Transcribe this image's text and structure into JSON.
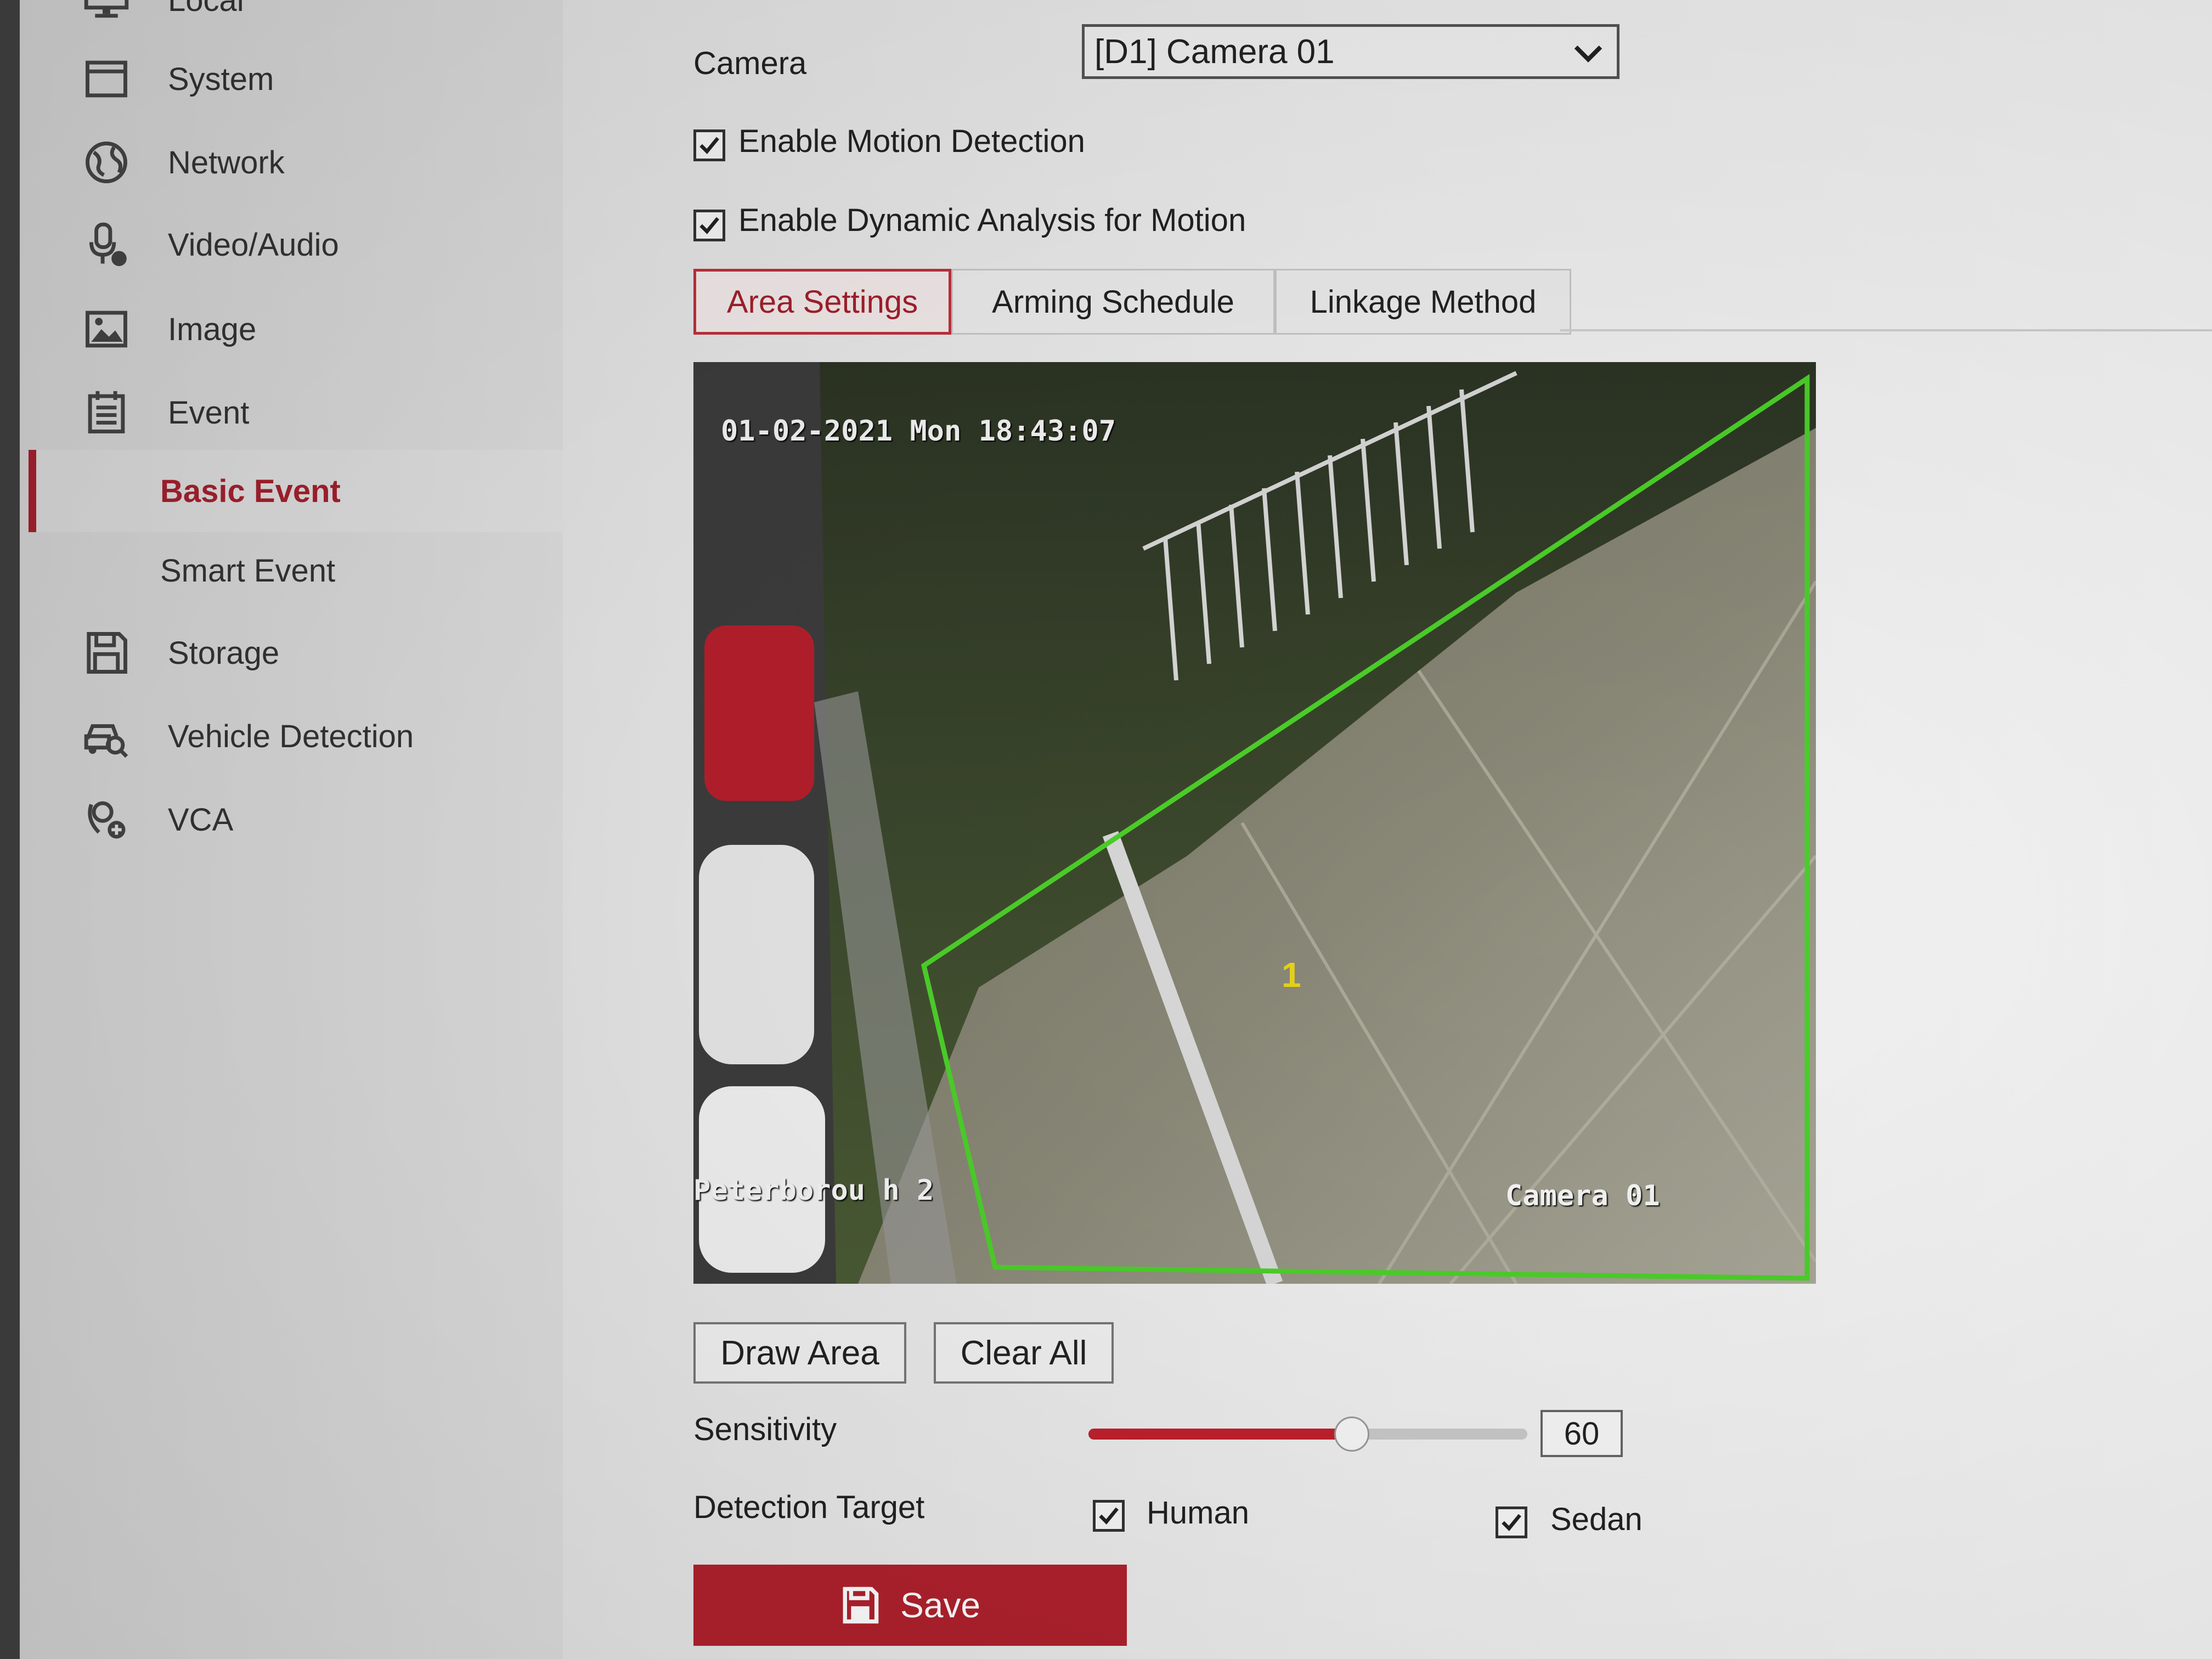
{
  "sidebar": {
    "items": [
      {
        "label": "Local",
        "icon": "monitor-icon"
      },
      {
        "label": "System",
        "icon": "system-icon"
      },
      {
        "label": "Network",
        "icon": "globe-icon"
      },
      {
        "label": "Video/Audio",
        "icon": "microphone-icon"
      },
      {
        "label": "Image",
        "icon": "image-icon"
      },
      {
        "label": "Event",
        "icon": "calendar-icon"
      },
      {
        "label": "Storage",
        "icon": "floppy-icon"
      },
      {
        "label": "Vehicle Detection",
        "icon": "vehicle-search-icon"
      },
      {
        "label": "VCA",
        "icon": "vca-icon"
      }
    ],
    "sub_items": [
      {
        "label": "Basic Event",
        "active": true
      },
      {
        "label": "Smart Event",
        "active": false
      }
    ],
    "accent_color": "#a3202d"
  },
  "form": {
    "camera_label": "Camera",
    "camera_value": "[D1] Camera 01",
    "enable_motion_label": "Enable Motion Detection",
    "enable_motion_checked": true,
    "enable_dynamic_label": "Enable Dynamic Analysis for Motion",
    "enable_dynamic_checked": true
  },
  "tabs": [
    {
      "label": "Area Settings",
      "active": true
    },
    {
      "label": "Arming Schedule",
      "active": false
    },
    {
      "label": "Linkage Method",
      "active": false
    }
  ],
  "video": {
    "timestamp": "01-02-2021 Mon 18:43:07",
    "location_osd": "Peterborou h 2",
    "camera_osd": "Camera 01",
    "area_number": "1",
    "area_color": "#4ccf2a"
  },
  "actions": {
    "draw_area": "Draw Area",
    "clear_all": "Clear All"
  },
  "sensitivity": {
    "label": "Sensitivity",
    "value": "60",
    "fraction": 0.6
  },
  "detection_target": {
    "label": "Detection Target",
    "human_label": "Human",
    "human_checked": true,
    "sedan_label": "Sedan",
    "sedan_checked": true
  },
  "save_label": "Save"
}
